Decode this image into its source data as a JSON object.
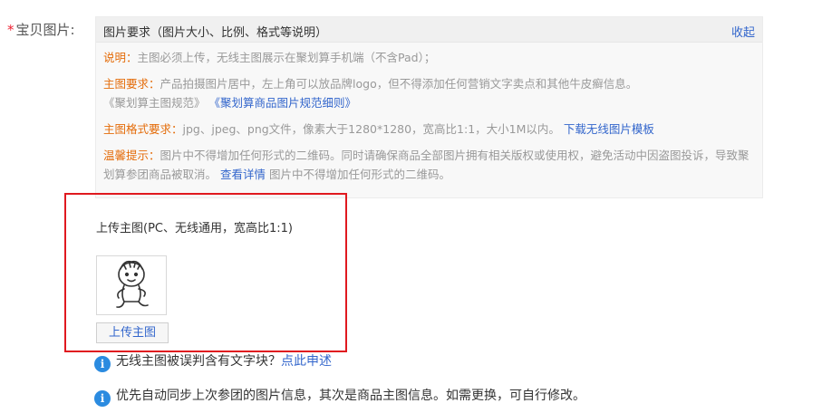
{
  "field": {
    "required_mark": "*",
    "label": "宝贝图片:"
  },
  "requirements": {
    "title": "图片要求（图片大小、比例、格式等说明）",
    "collapse": "收起",
    "note": {
      "key": "说明：",
      "text": "主图必须上传，无线主图展示在聚划算手机端（不含Pad）；"
    },
    "main": {
      "key": "主图要求：",
      "text": "产品拍摄图片居中，左上角可以放品牌logo，但不得添加任何营销文字卖点和其他牛皮癣信息。",
      "spec_text": "《聚划算主图规范》",
      "detail_link": "《聚划算商品图片规范细则》"
    },
    "format": {
      "key": "主图格式要求：",
      "text": "jpg、jpeg、png文件，像素大于1280*1280，宽高比1:1，大小1M以内。",
      "template_link": "下载无线图片模板"
    },
    "warning": {
      "key": "温馨提示：",
      "text": "图片中不得增加任何形式的二维码。同时请确保商品全部图片拥有相关版权或使用权，避免活动中因盗图投诉，导致聚划算参团商品被取消。",
      "detail_link": "查看详情",
      "tail": "图片中不得增加任何形式的二维码。"
    }
  },
  "upload": {
    "title": "上传主图(PC、无线通用，宽高比1:1)",
    "button": "上传主图",
    "thumb_icon": "cartoon-child-thumbnail"
  },
  "info": [
    {
      "icon": "info-icon",
      "text": "无线主图被误判含有文字块？",
      "link": "点此申述"
    },
    {
      "icon": "info-icon",
      "text": "优先自动同步上次参团的图片信息，其次是商品主图信息。如需更换，可自行修改。"
    }
  ],
  "colors": {
    "key": "#e46c0a",
    "link": "#3366cc",
    "frame": "#e0191f",
    "info": "#2b8be0"
  }
}
